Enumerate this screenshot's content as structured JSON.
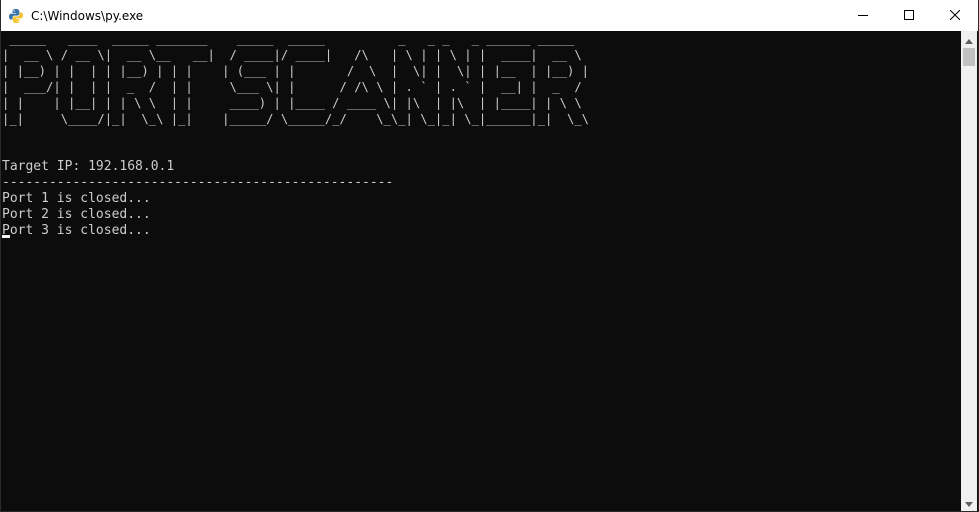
{
  "window": {
    "title": "C:\\Windows\\py.exe"
  },
  "icons": {
    "app": "python-icon",
    "minimize": "minimize-icon",
    "maximize": "maximize-icon",
    "close": "close-icon",
    "scroll_up": "chevron-up-icon",
    "scroll_down": "chevron-down-icon"
  },
  "colors": {
    "titlebar_bg": "#ffffff",
    "console_bg": "#0c0c0c",
    "console_fg": "#cccccc",
    "scrollbar_track": "#f0f0f0",
    "scrollbar_thumb": "#c1c1c1"
  },
  "console": {
    "banner": " _____   ____  _____ _______    _____  _____          _   _ _   _ ______ _____  \n|  __ \\ / __ \\|  __ \\__   __|  / ____|/ ____|   /\\   | \\ | | \\ | |  ____|  __ \\ \n| |__) | |  | | |__) | | |    | (___ | |       /  \\  |  \\| |  \\| | |__  | |__) |\n|  ___/| |  | |  _  /  | |     \\___ \\| |      / /\\ \\ | . ` | . ` |  __| |  _  / \n| |    | |__| | | \\ \\  | |     ____) | |____ / ____ \\| |\\  | |\\  | |____| | \\ \\ \n|_|     \\____/|_|  \\_\\ |_|    |_____/ \\_____/_/    \\_\\_| \\_|_| \\_|______|_|  \\_\\",
    "target_line": "Target IP: 192.168.0.1",
    "separator": "--------------------------------------------------",
    "lines": [
      "Port 1 is closed...",
      "Port 2 is closed...",
      "Port 3 is closed..."
    ]
  }
}
